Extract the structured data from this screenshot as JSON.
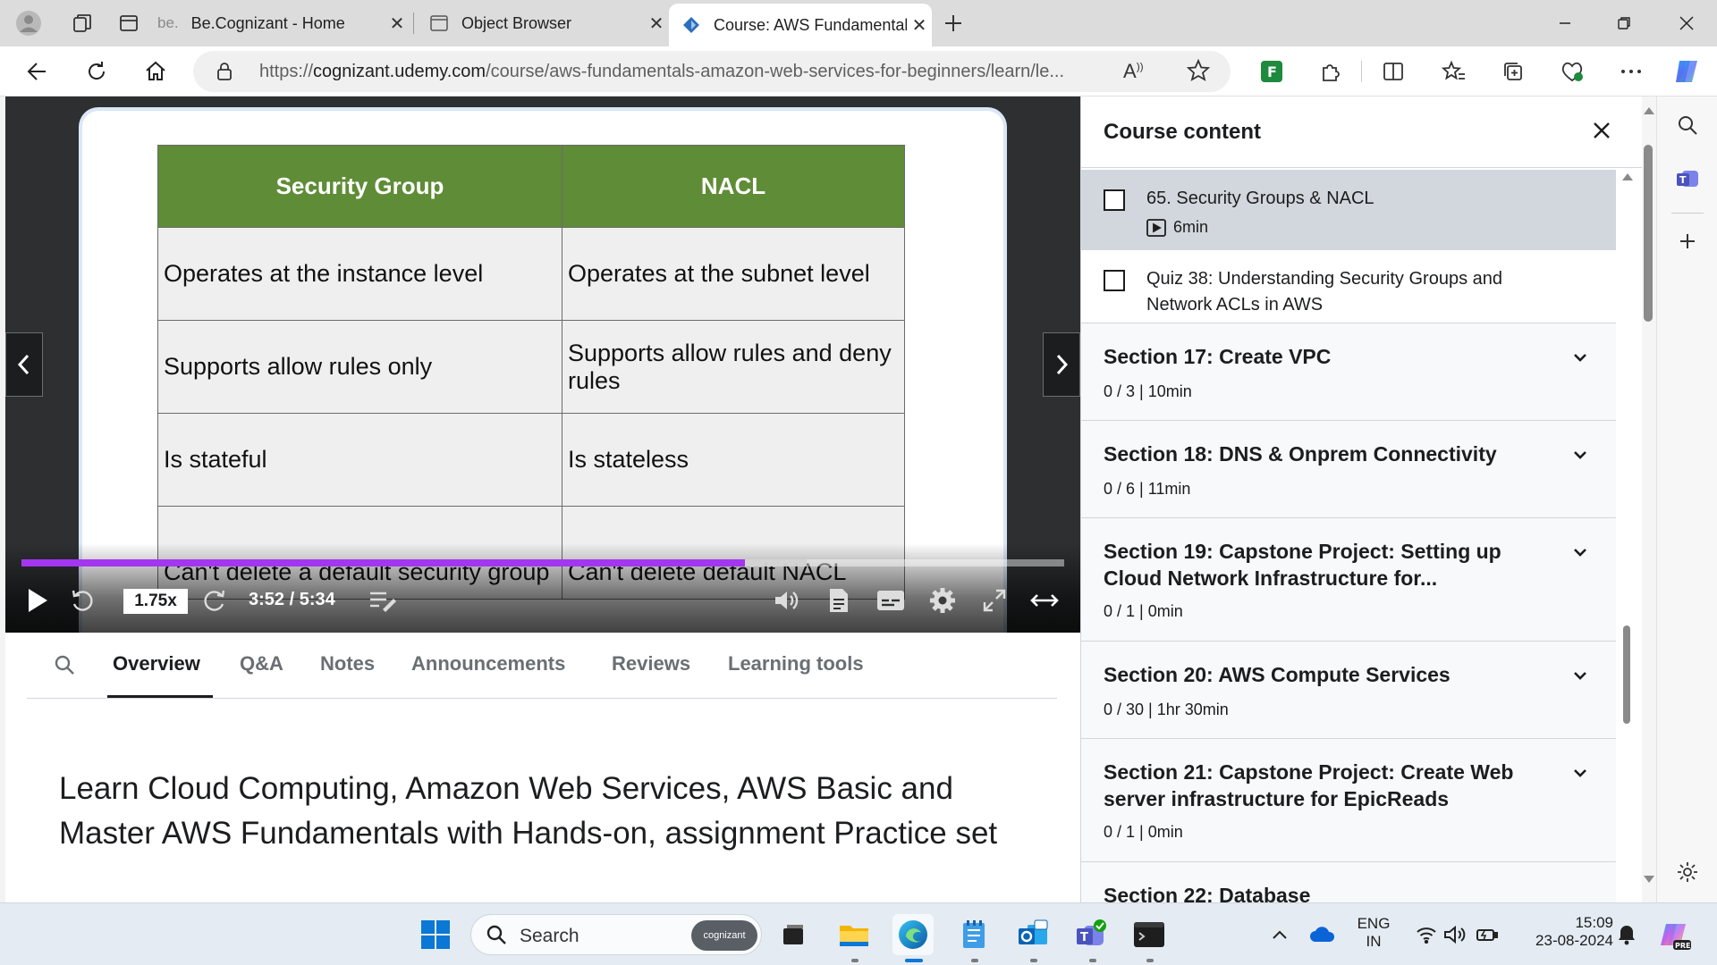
{
  "browser": {
    "tabs": [
      {
        "favicon_text": "be.",
        "title": "Be.Cognizant - Home"
      },
      {
        "title": "Object Browser"
      },
      {
        "title": "Course: AWS Fundamentals - Am",
        "active": true
      }
    ],
    "url_prefix": "https://",
    "url_host": "cognizant.udemy.com",
    "url_path": "/course/aws-fundamentals-amazon-web-services-for-beginners/learn/le..."
  },
  "slide": {
    "headers": [
      "Security Group",
      "NACL"
    ],
    "rows": [
      [
        "Operates at the instance level",
        "Operates at the subnet level"
      ],
      [
        "Supports allow rules only",
        "Supports allow rules and deny rules"
      ],
      [
        "Is stateful",
        "Is stateless"
      ],
      [
        "Can't delete a default security group",
        "Can't delete default NACL"
      ]
    ]
  },
  "player": {
    "speed": "1.75x",
    "time": "3:52 / 5:34",
    "progress_fraction": 0.694,
    "buffered_fraction": 0.753
  },
  "content_tabs": [
    "Overview",
    "Q&A",
    "Notes",
    "Announcements",
    "Reviews",
    "Learning tools"
  ],
  "active_tab": "Overview",
  "overview": {
    "description": "Learn Cloud Computing, Amazon Web Services, AWS Basic and Master AWS Fundamentals with Hands-on, assignment Practice set"
  },
  "sidebar": {
    "title": "Course content",
    "lectures": [
      {
        "title": "65. Security Groups & NACL",
        "duration": "6min",
        "current": true
      },
      {
        "title": "Quiz 38: Understanding Security Groups and Network ACLs in AWS"
      }
    ],
    "sections": [
      {
        "title": "Section 17: Create VPC",
        "meta": "0 / 3 | 10min"
      },
      {
        "title": "Section 18: DNS & Onprem Connectivity",
        "meta": "0 / 6 | 11min"
      },
      {
        "title": "Section 19: Capstone Project: Setting up Cloud Network Infrastructure for...",
        "meta": "0 / 1 | 0min"
      },
      {
        "title": "Section 20: AWS Compute Services",
        "meta": "0 / 30 | 1hr 30min"
      },
      {
        "title": "Section 21: Capstone Project: Create Web server infrastructure for EpicReads",
        "meta": "0 / 1 | 0min"
      },
      {
        "title": "Section 22: Database",
        "meta": ""
      }
    ]
  },
  "taskbar": {
    "search_placeholder": "Search",
    "search_badge": "cognizant",
    "lang_top": "ENG",
    "lang_bottom": "IN",
    "time": "15:09",
    "date": "23-08-2024",
    "copilot_badge": "PRE"
  },
  "colors": {
    "accent_purple": "#a435f0",
    "slide_header_green": "#5f8c36",
    "player_bg": "#2d2f31"
  }
}
